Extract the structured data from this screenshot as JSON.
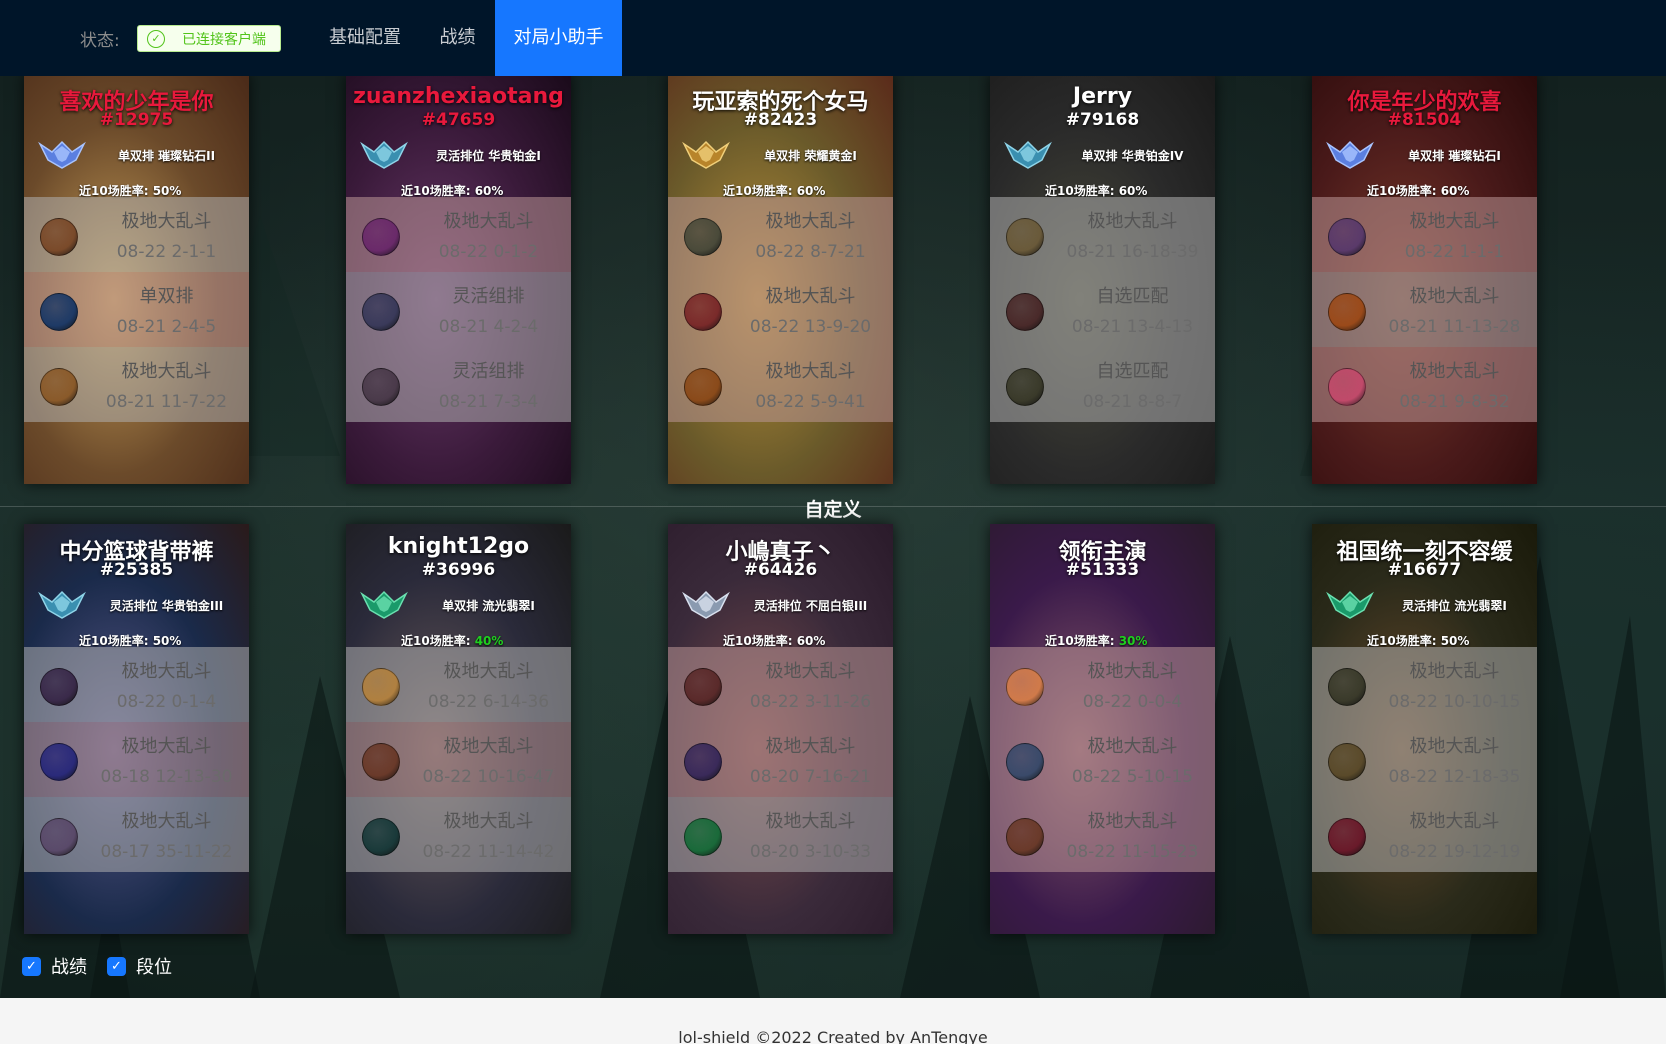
{
  "header": {
    "status_label": "状态:",
    "status_badge": "已连接客户端",
    "nav": [
      "基础配置",
      "战绩",
      "对局小助手"
    ],
    "active_tab": "对局小助手"
  },
  "divider_label": "自定义",
  "winrate_label": "近10场胜率:",
  "team1": [
    {
      "name": "喜欢的少年是你",
      "tag": "#12975",
      "red": true,
      "rank": "单双排 璀璨钻石II",
      "emblem": "diamond",
      "winrate": "50%",
      "bg": [
        "#6b4a2a",
        "#c9a05a",
        "#4a2a18"
      ],
      "matches": [
        {
          "mode": "极地大乱斗",
          "score": "08-22 2-1-1",
          "result": "win",
          "champ": "#7a4a2a"
        },
        {
          "mode": "单双排",
          "score": "08-21 2-4-5",
          "result": "loss",
          "champ": "#1e3a66"
        },
        {
          "mode": "极地大乱斗",
          "score": "08-21 11-7-22",
          "result": "win",
          "champ": "#8a5a2a"
        }
      ]
    },
    {
      "name": "zuanzhexiaotang",
      "tag": "#47659",
      "red": true,
      "rank": "灵活排位 华贵铂金I",
      "emblem": "platinum",
      "winrate": "60%",
      "bg": [
        "#3a1a3a",
        "#6a3a6a",
        "#1a0a1a"
      ],
      "matches": [
        {
          "mode": "极地大乱斗",
          "score": "08-22 0-1-2",
          "result": "loss",
          "champ": "#6a2a6a"
        },
        {
          "mode": "灵活组排",
          "score": "08-21 4-2-4",
          "result": "win",
          "champ": "#3a3a5a"
        },
        {
          "mode": "灵活组排",
          "score": "08-21 7-3-4",
          "result": "win",
          "champ": "#4a3a4a"
        }
      ]
    },
    {
      "name": "玩亚索的死个女马",
      "tag": "#82423",
      "red": false,
      "rank": "单双排 荣耀黄金I",
      "emblem": "gold",
      "winrate": "60%",
      "bg": [
        "#6a5a2a",
        "#b8903a",
        "#5a2a1a"
      ],
      "matches": [
        {
          "mode": "极地大乱斗",
          "score": "08-22 8-7-21",
          "result": "loss",
          "champ": "#4a4a3a"
        },
        {
          "mode": "极地大乱斗",
          "score": "08-22 13-9-20",
          "result": "loss",
          "champ": "#7a2a2a"
        },
        {
          "mode": "极地大乱斗",
          "score": "08-22 5-9-41",
          "result": "loss",
          "champ": "#8a4a1a"
        }
      ]
    },
    {
      "name": "Jerry",
      "tag": "#79168",
      "red": false,
      "rank": "单双排 华贵铂金IV",
      "emblem": "platinum",
      "winrate": "60%",
      "bg": [
        "#2a2a2a",
        "#4a4a3a",
        "#1a1a1a"
      ],
      "matches": [
        {
          "mode": "极地大乱斗",
          "score": "08-21 16-18-39",
          "result": "win",
          "champ": "#6a5a3a"
        },
        {
          "mode": "自选匹配",
          "score": "08-21 13-4-13",
          "result": "win",
          "champ": "#4a2a2a"
        },
        {
          "mode": "自选匹配",
          "score": "08-21 8-8-7",
          "result": "win",
          "champ": "#3a3a2a"
        }
      ]
    },
    {
      "name": "你是年少的欢喜",
      "tag": "#81504",
      "red": true,
      "rank": "单双排 璀璨钻石I",
      "emblem": "diamond",
      "winrate": "60%",
      "bg": [
        "#4a1a1a",
        "#7a3a2a",
        "#2a0a0a"
      ],
      "matches": [
        {
          "mode": "极地大乱斗",
          "score": "08-22 1-1-1",
          "result": "loss",
          "champ": "#5a3a6a"
        },
        {
          "mode": "极地大乱斗",
          "score": "08-21 11-13-28",
          "result": "win",
          "champ": "#9a4a1a"
        },
        {
          "mode": "极地大乱斗",
          "score": "08-21 9-8-32",
          "result": "loss",
          "champ": "#c04a6a"
        }
      ]
    }
  ],
  "team2": [
    {
      "name": "中分篮球背带裤",
      "tag": "#25385",
      "red": false,
      "rank": "灵活排位 华贵铂金III",
      "emblem": "platinum",
      "winrate": "50%",
      "bg": [
        "#1a2a4a",
        "#5a5a8a",
        "#2a1a1a"
      ],
      "matches": [
        {
          "mode": "极地大乱斗",
          "score": "08-22 0-1-4",
          "result": "win",
          "champ": "#3a2a4a"
        },
        {
          "mode": "极地大乱斗",
          "score": "08-18 12-13-30",
          "result": "loss",
          "champ": "#2a2a7a"
        },
        {
          "mode": "极地大乱斗",
          "score": "08-17 35-11-22",
          "result": "win",
          "champ": "#5a4a6a"
        }
      ]
    },
    {
      "name": "knight12go",
      "tag": "#36996",
      "red": false,
      "rank": "单双排 流光翡翠I",
      "emblem": "emerald",
      "winrate": "40%",
      "winrate_green": true,
      "bg": [
        "#2a2a3a",
        "#6a5a5a",
        "#1a1a1a"
      ],
      "matches": [
        {
          "mode": "极地大乱斗",
          "score": "08-22 6-14-36",
          "result": "win",
          "champ": "#b08040"
        },
        {
          "mode": "极地大乱斗",
          "score": "08-22 10-16-47",
          "result": "loss",
          "champ": "#6a3a2a"
        },
        {
          "mode": "极地大乱斗",
          "score": "08-22 11-14-42",
          "result": "win",
          "champ": "#1a3a3a"
        }
      ]
    },
    {
      "name": "小嶋真子丶",
      "tag": "#64426",
      "red": false,
      "rank": "灵活排位 不屈白银III",
      "emblem": "silver",
      "winrate": "60%",
      "bg": [
        "#3a2a3a",
        "#7a4a4a",
        "#2a1a2a"
      ],
      "matches": [
        {
          "mode": "极地大乱斗",
          "score": "08-22 3-11-26",
          "result": "loss",
          "champ": "#5a2a2a"
        },
        {
          "mode": "极地大乱斗",
          "score": "08-20 7-16-21",
          "result": "loss",
          "champ": "#3a2a5a"
        },
        {
          "mode": "极地大乱斗",
          "score": "08-20 3-10-33",
          "result": "win",
          "champ": "#1a6a3a"
        }
      ]
    },
    {
      "name": "领衔主演",
      "tag": "#51333",
      "red": false,
      "rank": "",
      "emblem": "",
      "winrate": "30%",
      "winrate_green": true,
      "bg": [
        "#3a1a4a",
        "#8a5a6a",
        "#2a1a2a"
      ],
      "matches": [
        {
          "mode": "极地大乱斗",
          "score": "08-22 0-0-4",
          "result": "loss",
          "champ": "#d07a4a"
        },
        {
          "mode": "极地大乱斗",
          "score": "08-22 5-10-15",
          "result": "loss",
          "champ": "#3a4a6a"
        },
        {
          "mode": "极地大乱斗",
          "score": "08-22 11-15-23",
          "result": "loss",
          "champ": "#6a3a2a"
        }
      ]
    },
    {
      "name": "祖国统一刻不容缓",
      "tag": "#16677",
      "red": false,
      "rank": "灵活排位 流光翡翠I",
      "emblem": "emerald",
      "winrate": "50%",
      "bg": [
        "#2a2a1a",
        "#6a4a2a",
        "#1a1a0a"
      ],
      "matches": [
        {
          "mode": "极地大乱斗",
          "score": "08-22 10-10-15",
          "result": "win",
          "champ": "#3a3a2a"
        },
        {
          "mode": "极地大乱斗",
          "score": "08-22 12-18-35",
          "result": "win",
          "champ": "#5a4a2a"
        },
        {
          "mode": "极地大乱斗",
          "score": "08-22 19-12-19",
          "result": "win",
          "champ": "#6a1a2a"
        }
      ]
    }
  ],
  "options": {
    "record": "战绩",
    "rank": "段位"
  },
  "footer": "lol-shield ©2022 Created by AnTengye",
  "colors": {
    "header_bg": "#001529",
    "accent": "#1677ff",
    "status_green": "#52c41a",
    "name_red": "#e8193c"
  }
}
